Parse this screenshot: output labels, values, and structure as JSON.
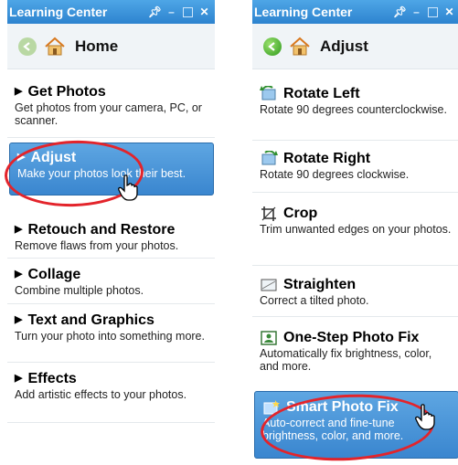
{
  "left_panel": {
    "title": "Learning Center",
    "nav_title": "Home",
    "items": [
      {
        "label": "Get Photos",
        "desc": "Get photos from your camera, PC, or scanner."
      },
      {
        "label": "Adjust",
        "desc": "Make your photos look their best."
      },
      {
        "label": "Retouch and Restore",
        "desc": "Remove flaws from your photos."
      },
      {
        "label": "Collage",
        "desc": "Combine multiple photos."
      },
      {
        "label": "Text and Graphics",
        "desc": "Turn your photo into something more."
      },
      {
        "label": "Effects",
        "desc": "Add artistic effects to your photos."
      }
    ]
  },
  "right_panel": {
    "title": "Learning Center",
    "nav_title": "Adjust",
    "items": [
      {
        "label": "Rotate Left",
        "desc": "Rotate 90 degrees counterclockwise.",
        "icon": "rotate-left-icon"
      },
      {
        "label": "Rotate Right",
        "desc": "Rotate 90 degrees clockwise.",
        "icon": "rotate-right-icon"
      },
      {
        "label": "Crop",
        "desc": "Trim unwanted edges on your photos.",
        "icon": "crop-icon"
      },
      {
        "label": "Straighten",
        "desc": "Correct a tilted photo.",
        "icon": "straighten-icon"
      },
      {
        "label": "One-Step Photo Fix",
        "desc": "Automatically fix brightness, color, and more.",
        "icon": "photo-fix-icon"
      },
      {
        "label": "Smart Photo Fix",
        "desc": "Auto-correct and fine-tune brightness, color, and more.",
        "icon": "smart-fix-icon"
      }
    ]
  },
  "colors": {
    "titlebar": "#3a93dc",
    "selected": "#4a95d8",
    "highlight_ellipse": "#e3242b"
  }
}
